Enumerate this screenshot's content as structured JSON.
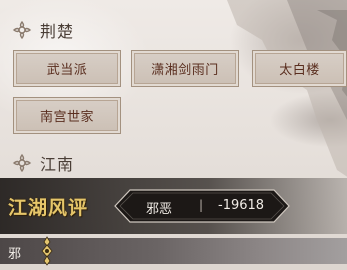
{
  "regions": [
    {
      "name": "荆楚",
      "sects": [
        "武当派",
        "潇湘剑雨门",
        "太白楼",
        "南宫世家"
      ]
    },
    {
      "name": "江南"
    }
  ],
  "reputation": {
    "title": "江湖风评",
    "label": "邪恶",
    "separator": "|",
    "value": "-19618"
  },
  "meter": {
    "label": "邪"
  },
  "colors": {
    "title_gold": "#e6c66a",
    "button_text": "#5a2e1f",
    "banner_dark": "#1e1a18"
  }
}
